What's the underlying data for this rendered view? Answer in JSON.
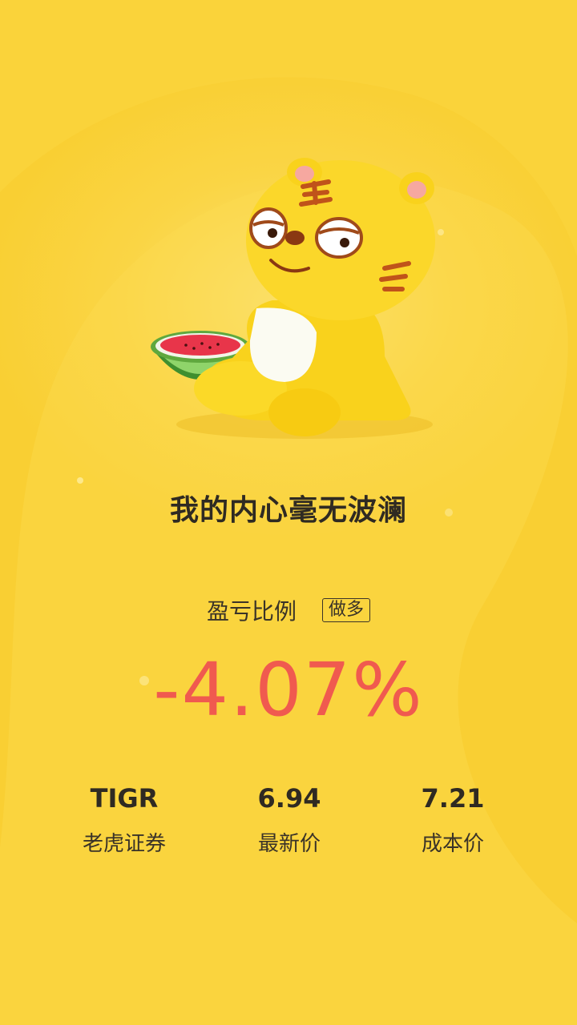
{
  "headline": "我的内心毫无波澜",
  "pl": {
    "label": "盈亏比例",
    "side_badge": "做多",
    "value": "-4.07%",
    "color": "#f05a4f"
  },
  "stats": [
    {
      "value": "TIGR",
      "label": "老虎证券"
    },
    {
      "value": "6.94",
      "label": "最新价"
    },
    {
      "value": "7.21",
      "label": "成本价"
    }
  ],
  "colors": {
    "background": "#fad545",
    "text": "#2f2a22"
  },
  "illustration": {
    "subject": "tiger-mascot-with-watermelon"
  }
}
